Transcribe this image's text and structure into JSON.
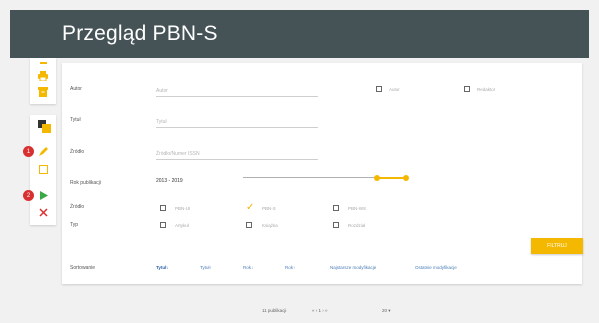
{
  "header": {
    "title": "Przegląd PBN-S"
  },
  "toolbar": {
    "icons": [
      "minus-icon",
      "print-icon",
      "archive-icon",
      "copy-icon",
      "edit-icon",
      "square-icon",
      "play-icon",
      "close-icon"
    ],
    "badges": [
      "1",
      "2"
    ],
    "colors": {
      "accent": "#f5b800",
      "danger": "#d83030",
      "play": "#3aa845"
    }
  },
  "form": {
    "autor": {
      "label": "Autor",
      "placeholder": "Autor"
    },
    "tytul": {
      "label": "Tytuł",
      "placeholder": "Tytuł"
    },
    "zrodlo": {
      "label": "Źródło",
      "placeholder": "Źródło/Numer ISSN"
    },
    "rok": {
      "label": "Rok publikacji",
      "value": "2013 - 2019"
    },
    "autor_cb": "Autor",
    "redaktor_cb": "Redaktor",
    "zrodlo_opts": {
      "label": "Źródło",
      "opts": [
        "PBN-UI",
        "PBN-S",
        "PBN-WS"
      ],
      "checked": 1
    },
    "typ_opts": {
      "label": "Typ",
      "opts": [
        "Artykuł",
        "Książka",
        "Rozdział"
      ]
    }
  },
  "filter_button": "FILTRUJ",
  "sort": {
    "label": "Sortowanie",
    "links": [
      "Tytuł↓",
      "Tytuł↑",
      "Rok↓",
      "Rok↑",
      "Najstarsze modyfikacje",
      "Ostatnie modyfikacje"
    ]
  },
  "pagination": {
    "count": "11 publikacji",
    "pages": "«  ‹  1  ›  »",
    "per_page": "20 ▾"
  }
}
